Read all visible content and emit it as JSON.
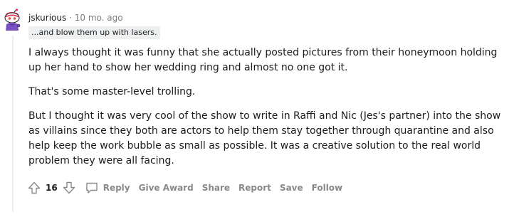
{
  "comment": {
    "username": "jskurious",
    "separator": "·",
    "timestamp": "10 mo. ago",
    "flair": "...and blow them up with lasers.",
    "paragraphs": [
      "I always thought it was funny that she actually posted pictures from their honeymoon holding up her hand to show her wedding ring and almost no one got it.",
      "That's some master-level trolling.",
      "But I thought it was very cool of the show to write in Raffi and Nic (Jes's partner) into the show as villains since they both are actors to help them stay together through quarantine and also help keep the work bubble as small as possible. It was a creative solution to the real world problem they were all facing."
    ]
  },
  "actions": {
    "score": "16",
    "reply_label": "Reply",
    "give_award_label": "Give Award",
    "share_label": "Share",
    "report_label": "Report",
    "save_label": "Save",
    "follow_label": "Follow"
  },
  "icons": {
    "upvote": "upvote-arrow-icon",
    "downvote": "downvote-arrow-icon",
    "reply": "speech-bubble-icon",
    "avatar": "snoo-avatar"
  },
  "colors": {
    "text": "#1c1c1c",
    "meta": "#7c7c7c",
    "action": "#878a8c",
    "flair_bg": "#edeff1",
    "avatar_accent": "#d93a5a"
  }
}
